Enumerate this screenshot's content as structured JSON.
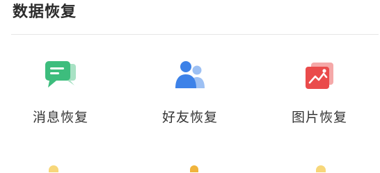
{
  "section": {
    "title": "数据恢复"
  },
  "tiles": [
    {
      "label": "消息恢复",
      "icon": "message-bubble-icon",
      "color": "#3dbd7d"
    },
    {
      "label": "好友恢复",
      "icon": "contacts-icon",
      "color": "#3d82e8"
    },
    {
      "label": "图片恢复",
      "icon": "picture-icon",
      "color": "#ea4b4b"
    }
  ],
  "colors": {
    "title": "#2b2b2b",
    "label": "#333333",
    "divider": "#e6e6e6"
  }
}
